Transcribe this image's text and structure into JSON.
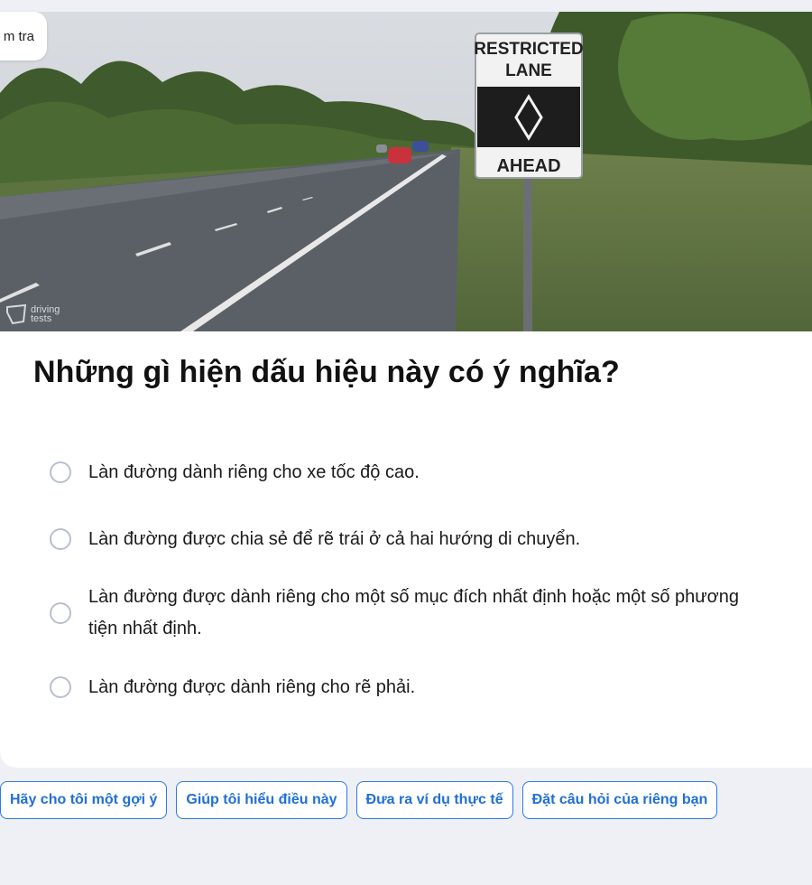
{
  "top_tab": {
    "label": "m tra"
  },
  "image": {
    "sign_line1": "RESTRICTED",
    "sign_line2": "LANE",
    "sign_line3": "AHEAD",
    "watermark_line1": "driving",
    "watermark_line2": "tests"
  },
  "question": {
    "text": "Những gì hiện dấu hiệu này có ý nghĩa?"
  },
  "options": [
    {
      "label": "Làn đường dành riêng cho xe tốc độ cao."
    },
    {
      "label": "Làn đường được chia sẻ để rẽ trái ở cả hai hướng di chuyển."
    },
    {
      "label": "Làn đường được dành riêng cho một số mục đích nhất định hoặc một số phương tiện nhất định."
    },
    {
      "label": "Làn đường được dành riêng cho rẽ phải."
    }
  ],
  "help_chips": [
    {
      "label": "Hãy cho tôi một gợi ý"
    },
    {
      "label": "Giúp tôi hiểu điều này"
    },
    {
      "label": "Đưa ra ví dụ thực tế"
    },
    {
      "label": "Đặt câu hỏi của riêng bạn"
    }
  ],
  "colors": {
    "accent": "#2c7be5",
    "background": "#eef0f5",
    "radio_border": "#b9bfcc"
  }
}
